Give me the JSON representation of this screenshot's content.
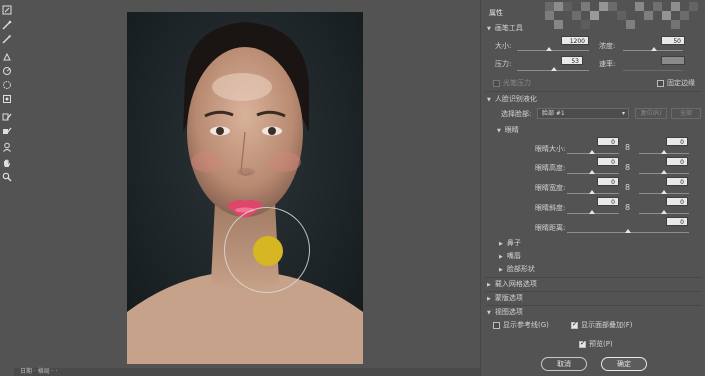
{
  "tools": [
    {
      "name": "face-tool-icon"
    },
    {
      "name": "forward-warp-tool-icon"
    },
    {
      "name": "reconstruct-tool-icon"
    },
    {
      "name": "smooth-tool-icon"
    },
    {
      "name": "twirl-tool-icon"
    },
    {
      "name": "pucker-tool-icon"
    },
    {
      "name": "bloat-tool-icon"
    },
    {
      "name": "push-left-tool-icon"
    },
    {
      "name": "freeze-mask-tool-icon"
    },
    {
      "name": "thaw-mask-tool-icon"
    },
    {
      "name": "face-select-tool-icon"
    },
    {
      "name": "hand-tool-icon"
    },
    {
      "name": "zoom-tool-icon"
    }
  ],
  "status": {
    "text": "日期 · 格局 · ·"
  },
  "panel": {
    "title": "属性",
    "brush_tools": {
      "heading": "画笔工具",
      "size_label": "大小:",
      "size_value": "1200",
      "density_label": "浓度:",
      "density_value": "50",
      "pressure_label": "压力:",
      "pressure_value": "53",
      "rate_label": "速率:",
      "rate_value": "",
      "stylus_label": "光笔压力",
      "pin_edges_label": "固定边缘"
    },
    "face_aware": {
      "heading": "人脸识别液化",
      "select_face_label": "选择脸部:",
      "select_face_value": "脸部 #1",
      "reset_label": "复位(R)",
      "all_label": "全部",
      "eyes_heading": "眼睛",
      "eye_size_label": "眼睛大小:",
      "eye_size_left": "0",
      "eye_size_right": "0",
      "eye_height_label": "眼睛高度:",
      "eye_height_left": "0",
      "eye_height_right": "0",
      "eye_width_label": "眼睛宽度:",
      "eye_width_left": "0",
      "eye_width_right": "0",
      "eye_tilt_label": "眼睛斜度:",
      "eye_tilt_left": "0",
      "eye_tilt_right": "0",
      "eye_distance_label": "眼睛距离:",
      "eye_distance_value": "0",
      "nose_label": "鼻子",
      "mouth_label": "嘴唇",
      "face_shape_label": "脸部形状"
    },
    "load_mesh_label": "载入网格选项",
    "mask_options_label": "蒙版选项",
    "view_options": {
      "heading": "视图选项",
      "show_guides_label": "显示参考线(G)",
      "show_guides_checked": false,
      "show_overlay_label": "显示面部叠加(F)",
      "show_overlay_checked": true
    },
    "preview_label": "预览(P)",
    "preview_checked": true,
    "cancel_label": "取消",
    "ok_label": "确定"
  },
  "colors": {
    "background": "#535353",
    "brush_center": "#d6b623",
    "photo_background": "#1d2427"
  }
}
